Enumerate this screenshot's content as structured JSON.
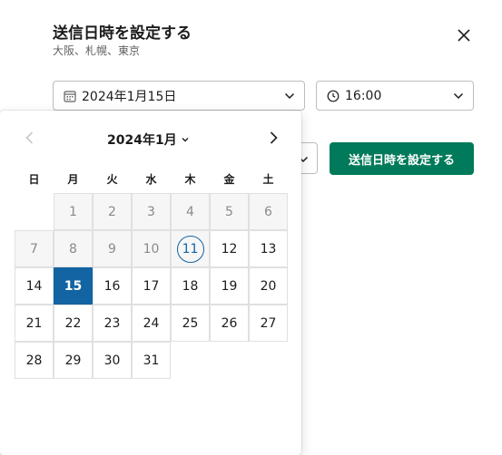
{
  "dialog": {
    "title": "送信日時を設定する",
    "subtitle": "大阪、札幌、東京",
    "close_icon": "close-icon"
  },
  "date_select": {
    "value": "2024年1月15日",
    "icon": "calendar-icon"
  },
  "time_select": {
    "value": "16:00",
    "icon": "clock-icon"
  },
  "submit_label": "送信日時を設定する",
  "colors": {
    "accent": "#007a5a",
    "selected": "#1264a3"
  },
  "calendar": {
    "month_label": "2024年1月",
    "weekdays": [
      "日",
      "月",
      "火",
      "水",
      "木",
      "金",
      "土"
    ],
    "selected_day": "15",
    "today": "11",
    "weeks": [
      [
        "",
        "1",
        "2",
        "3",
        "4",
        "5",
        "6"
      ],
      [
        "7",
        "8",
        "9",
        "10",
        "11",
        "12",
        "13"
      ],
      [
        "14",
        "15",
        "16",
        "17",
        "18",
        "19",
        "20"
      ],
      [
        "21",
        "22",
        "23",
        "24",
        "25",
        "26",
        "27"
      ],
      [
        "28",
        "29",
        "30",
        "31",
        "",
        "",
        ""
      ]
    ],
    "past_days": [
      "1",
      "2",
      "3",
      "4",
      "5",
      "6",
      "7",
      "8",
      "9",
      "10"
    ]
  }
}
